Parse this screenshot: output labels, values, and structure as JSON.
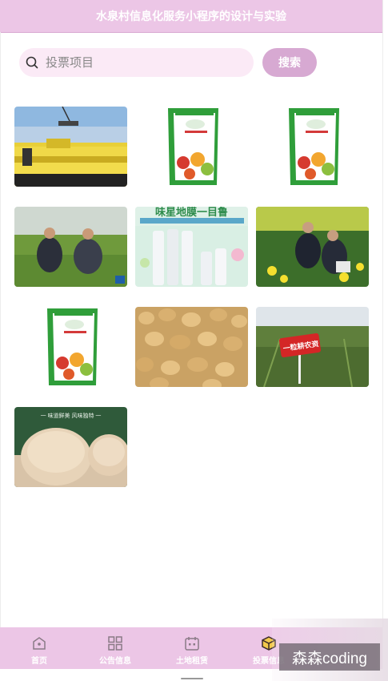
{
  "header": {
    "title": "水泉村信息化服务小程序的设计与实验"
  },
  "search": {
    "placeholder": "投票项目",
    "value": "",
    "button_label": "搜索"
  },
  "projects": [
    {
      "name": "fertilizer-harvest-photo"
    },
    {
      "name": "seed-bag-photo"
    },
    {
      "name": "seed-bag-photo"
    },
    {
      "name": "farmers-in-field-photo"
    },
    {
      "name": "film-rolls-photo",
      "banner_text": "味星地膜一目鲁"
    },
    {
      "name": "farmers-rapeseed-photo"
    },
    {
      "name": "seed-bag-photo"
    },
    {
      "name": "soybeans-photo"
    },
    {
      "name": "field-sign-photo",
      "sign_text": "一粒耕农资"
    },
    {
      "name": "mushroom-photo",
      "caption_text": "一 味道鲜美 风味独特 一"
    }
  ],
  "tabbar": {
    "items": [
      {
        "label": "首页",
        "icon": "home-icon"
      },
      {
        "label": "公告信息",
        "icon": "grid-icon"
      },
      {
        "label": "土地租赁",
        "icon": "calendar-icon"
      },
      {
        "label": "投票信息",
        "icon": "box-icon"
      }
    ]
  },
  "watermark": {
    "text": "森森coding"
  },
  "colors": {
    "primary": "#ecc6e6",
    "button": "#d7a9d2",
    "search_bg": "#fbeaf6"
  }
}
